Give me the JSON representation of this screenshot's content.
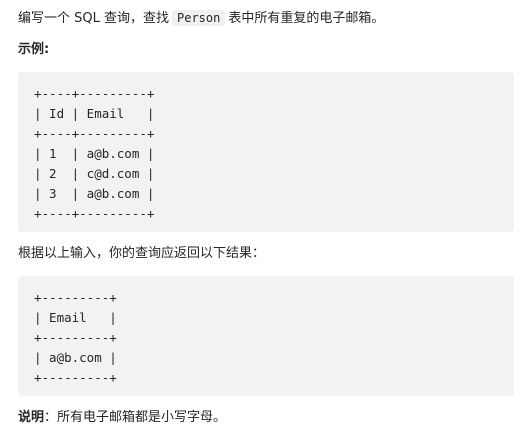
{
  "intro": {
    "before": "编写一个 SQL 查询，查找",
    "code": "Person",
    "after": "表中所有重复的电子邮箱。"
  },
  "example_label": "示例:",
  "input_table": "+----+---------+\n| Id | Email   |\n+----+---------+\n| 1  | a@b.com |\n| 2  | c@d.com |\n| 3  | a@b.com |\n+----+---------+",
  "result_label": "根据以上输入，你的查询应返回以下结果：",
  "output_table": "+---------+\n| Email   |\n+---------+\n| a@b.com |\n+---------+",
  "note": {
    "key": "说明",
    "text": "：所有电子邮箱都是小写字母。"
  }
}
